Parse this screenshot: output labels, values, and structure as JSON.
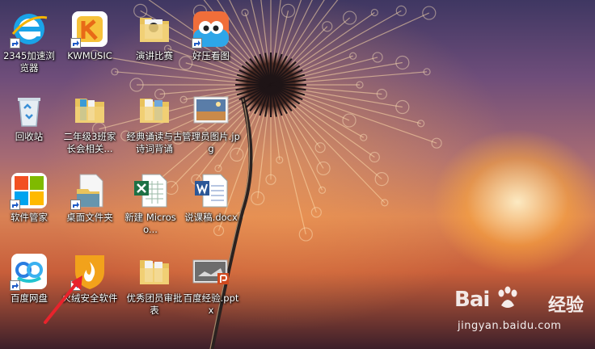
{
  "desktop": {
    "icons": [
      {
        "label": "2345加速浏览器",
        "icon": "ie-browser-icon"
      },
      {
        "label": "KWMUSIC",
        "icon": "kwmusic-icon"
      },
      {
        "label": "演讲比赛",
        "icon": "folder-icon"
      },
      {
        "label": "好压看图",
        "icon": "image-viewer-icon"
      },
      {
        "label": "回收站",
        "icon": "recycle-bin-icon"
      },
      {
        "label": "二年级3班家长会相关...",
        "icon": "folder-icon"
      },
      {
        "label": "经典诵读与古诗词背诵",
        "icon": "folder-icon"
      },
      {
        "label": "管理员图片.jpg",
        "icon": "jpg-file-icon"
      },
      {
        "label": "软件管家",
        "icon": "software-manager-icon"
      },
      {
        "label": "桌面文件夹",
        "icon": "folder-icon"
      },
      {
        "label": "新建 Microso...",
        "icon": "excel-file-icon"
      },
      {
        "label": "说课稿.docx",
        "icon": "word-file-icon"
      },
      {
        "label": "百度网盘",
        "icon": "baidu-netdisk-icon"
      },
      {
        "label": "火绒安全软件",
        "icon": "huorong-icon"
      },
      {
        "label": "优秀团员审批表",
        "icon": "folder-icon"
      },
      {
        "label": "百度经验.pptx",
        "icon": "pptx-file-icon"
      }
    ]
  },
  "watermark": {
    "brand": "Bai",
    "brand_suffix": "经验",
    "url": "jingyan.baidu.com"
  },
  "colors": {
    "arrow": "#e8232c",
    "word_blue": "#2b5797",
    "excel_green": "#1e7145",
    "ppt_orange": "#d04a1f",
    "folder_yellow": "#e9c35c"
  }
}
